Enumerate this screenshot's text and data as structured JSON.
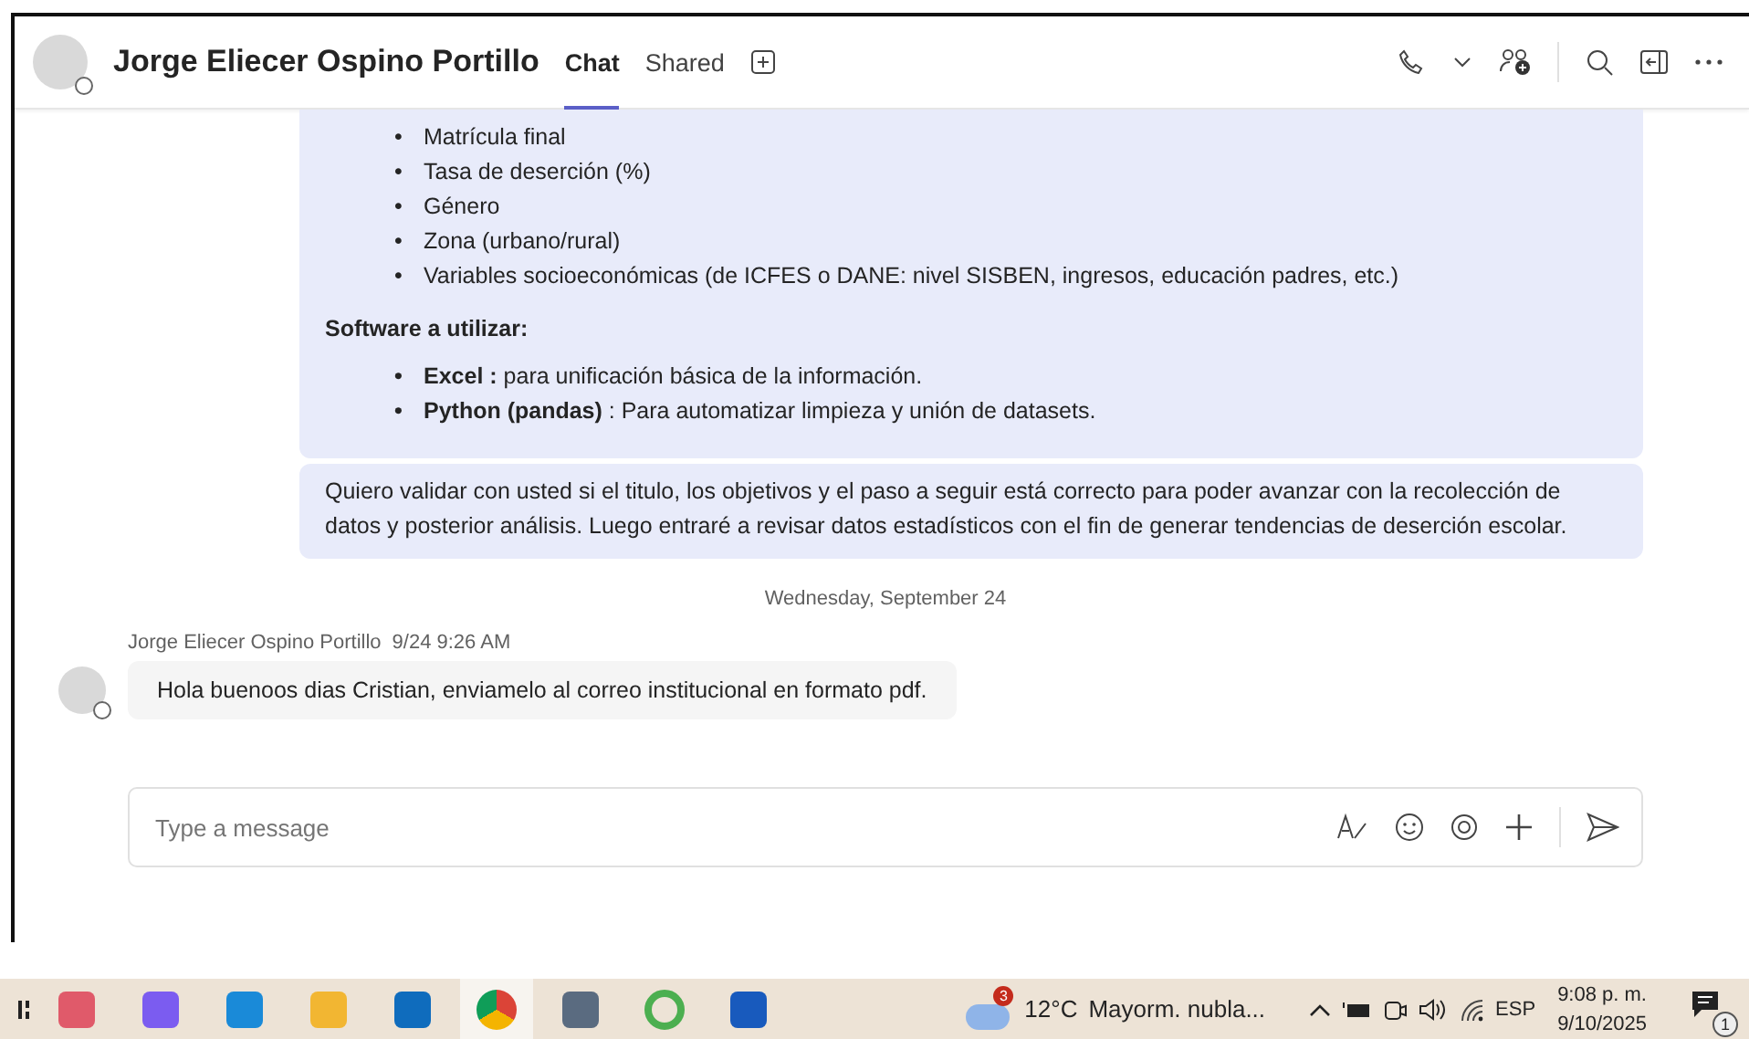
{
  "header": {
    "title": "Jorge Eliecer Ospino Portillo",
    "tabs": [
      {
        "label": "Chat",
        "selected": true
      },
      {
        "label": "Shared",
        "selected": false
      }
    ]
  },
  "sent": {
    "list_items": [
      {
        "bullet": "•",
        "text": "Matrícula final"
      },
      {
        "bullet": "•",
        "text": "Tasa de deserción (%)"
      },
      {
        "bullet": "•",
        "text": "Género"
      },
      {
        "bullet": "•",
        "text": "Zona (urbano/rural)"
      },
      {
        "bullet": "•",
        "text": "Variables socioeconómicas (de ICFES o DANE: nivel SISBEN, ingresos, educación padres, etc.)"
      }
    ],
    "software_heading": "Software a utilizar:",
    "software_items": [
      {
        "bullet": "•",
        "text": "**Excel :** para unificación básica de la información."
      },
      {
        "bullet": "•",
        "text": "**Python (pandas)** : Para automatizar limpieza y unión de datasets."
      }
    ],
    "second_message": "Quiero validar con usted si el titulo, los objetivos y el paso a seguir está correcto para poder avanzar con la recolección de datos y posterior análisis. Luego entraré a revisar datos estadísticos con el fin de generar tendencias de deserción escolar."
  },
  "date_divider": "Wednesday, September 24",
  "received": {
    "sender": "Jorge Eliecer Ospino Portillo",
    "time": "9/24 9:26 AM",
    "text": "Hola buenoos dias Cristian, enviamelo al correo institucional en formato pdf."
  },
  "composer": {
    "placeholder": "Type a message"
  },
  "taskbar": {
    "apps": [
      {
        "kind": "snip",
        "selected": false
      },
      {
        "kind": "copilot",
        "selected": false
      },
      {
        "kind": "edge",
        "selected": false
      },
      {
        "kind": "folder",
        "selected": false
      },
      {
        "kind": "outlook",
        "selected": false
      },
      {
        "kind": "chrome",
        "selected": true
      },
      {
        "kind": "calculator",
        "selected": false
      },
      {
        "kind": "ring",
        "selected": false
      },
      {
        "kind": "word",
        "selected": false
      }
    ],
    "weather": {
      "badge": "3",
      "temperature": "12°C",
      "condition": "Mayorm. nubla..."
    },
    "language": "ESP",
    "time": "9:08 p. m.",
    "date": "9/10/2025",
    "notification_badge": "1"
  }
}
